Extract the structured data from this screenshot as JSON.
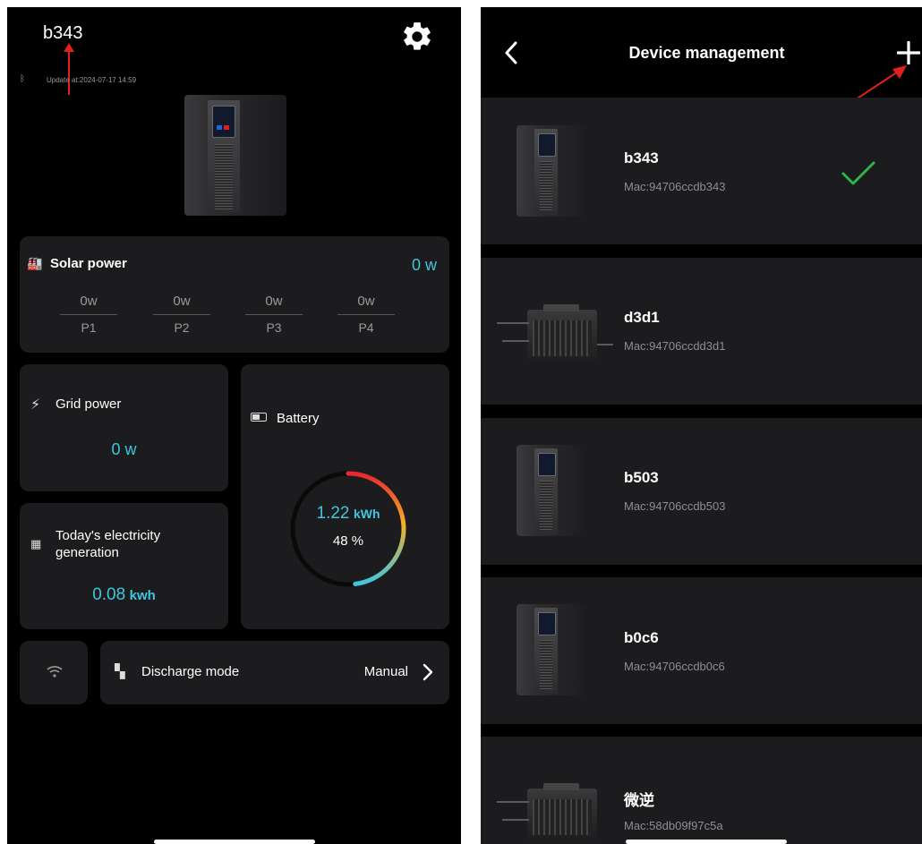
{
  "left": {
    "device_name": "b343",
    "update_text": "Update at:2024-07-17 14:59",
    "solar": {
      "title": "Solar power",
      "value": "0",
      "unit": "w",
      "ports": [
        {
          "value": "0w",
          "label": "P1"
        },
        {
          "value": "0w",
          "label": "P2"
        },
        {
          "value": "0w",
          "label": "P3"
        },
        {
          "value": "0w",
          "label": "P4"
        }
      ]
    },
    "grid": {
      "title": "Grid power",
      "value": "0",
      "unit": "w"
    },
    "battery": {
      "title": "Battery",
      "energy": "1.22",
      "energy_unit": "kWh",
      "percent_text": "48 %",
      "percent": 48
    },
    "generation": {
      "title_line1": "Today's electricity",
      "title_line2": "generation",
      "value": "0.08",
      "unit": "kwh"
    },
    "discharge": {
      "label": "Discharge mode",
      "value": "Manual"
    }
  },
  "right": {
    "title": "Device management",
    "devices": [
      {
        "name": "b343",
        "mac": "Mac:94706ccdb343",
        "type": "battery",
        "selected": true
      },
      {
        "name": "d3d1",
        "mac": "Mac:94706ccdd3d1",
        "type": "inverter",
        "selected": false
      },
      {
        "name": "b503",
        "mac": "Mac:94706ccdb503",
        "type": "battery",
        "selected": false
      },
      {
        "name": "b0c6",
        "mac": "Mac:94706ccdb0c6",
        "type": "battery",
        "selected": false
      },
      {
        "name": "微逆",
        "mac": "Mac:58db09f97c5a",
        "type": "inverter",
        "selected": false
      }
    ]
  },
  "colors": {
    "accent": "#3ec6e0",
    "check": "#2fb64a",
    "annotation": "#e0201c",
    "card": "#1c1c1e"
  }
}
